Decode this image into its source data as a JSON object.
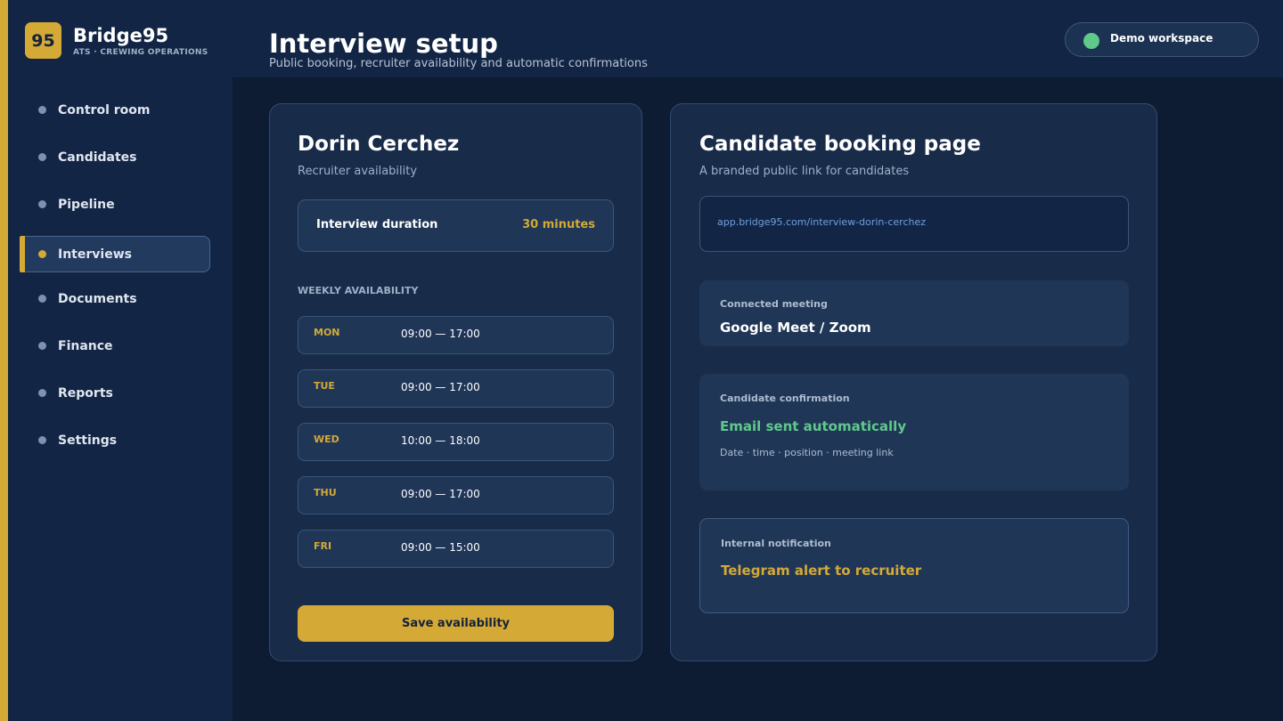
{
  "app": {
    "logo_text": "95",
    "name": "Bridge95",
    "tagline": "ATS · CREWING OPERATIONS"
  },
  "nav": {
    "items": [
      {
        "label": "Control room"
      },
      {
        "label": "Candidates"
      },
      {
        "label": "Pipeline"
      },
      {
        "label": "Interviews",
        "active": true
      },
      {
        "label": "Documents"
      },
      {
        "label": "Finance"
      },
      {
        "label": "Reports"
      },
      {
        "label": "Settings"
      }
    ]
  },
  "header": {
    "title": "Interview setup",
    "subtitle": "Public booking, recruiter availability and automatic confirmations",
    "workspace_label": "Demo workspace",
    "workspace_status_color": "#5fc98a"
  },
  "availability": {
    "recruiter_name": "Dorin Cerchez",
    "subtitle": "Recruiter availability",
    "duration_label": "Interview duration",
    "duration_value": "30 minutes",
    "section_heading": "WEEKLY AVAILABILITY",
    "days": [
      {
        "day": "MON",
        "hours": "09:00 — 17:00"
      },
      {
        "day": "TUE",
        "hours": "09:00 — 17:00"
      },
      {
        "day": "WED",
        "hours": "10:00 — 18:00"
      },
      {
        "day": "THU",
        "hours": "09:00 — 17:00"
      },
      {
        "day": "FRI",
        "hours": "09:00 — 15:00"
      }
    ],
    "save_label": "Save availability"
  },
  "booking": {
    "title": "Candidate booking page",
    "subtitle": "A branded public link for candidates",
    "link": "app.bridge95.com/interview-dorin-cerchez",
    "meeting": {
      "label": "Connected meeting",
      "value": "Google Meet / Zoom"
    },
    "confirmation": {
      "label": "Candidate confirmation",
      "value": "Email sent automatically",
      "detail": "Date · time · position · meeting link"
    },
    "notification": {
      "label": "Internal notification",
      "value": "Telegram alert to recruiter"
    }
  },
  "colors": {
    "accent": "#d4a936",
    "success": "#5fc98a",
    "link": "#6f9fe0",
    "background": "#0e1c33",
    "panel": "#132544"
  }
}
